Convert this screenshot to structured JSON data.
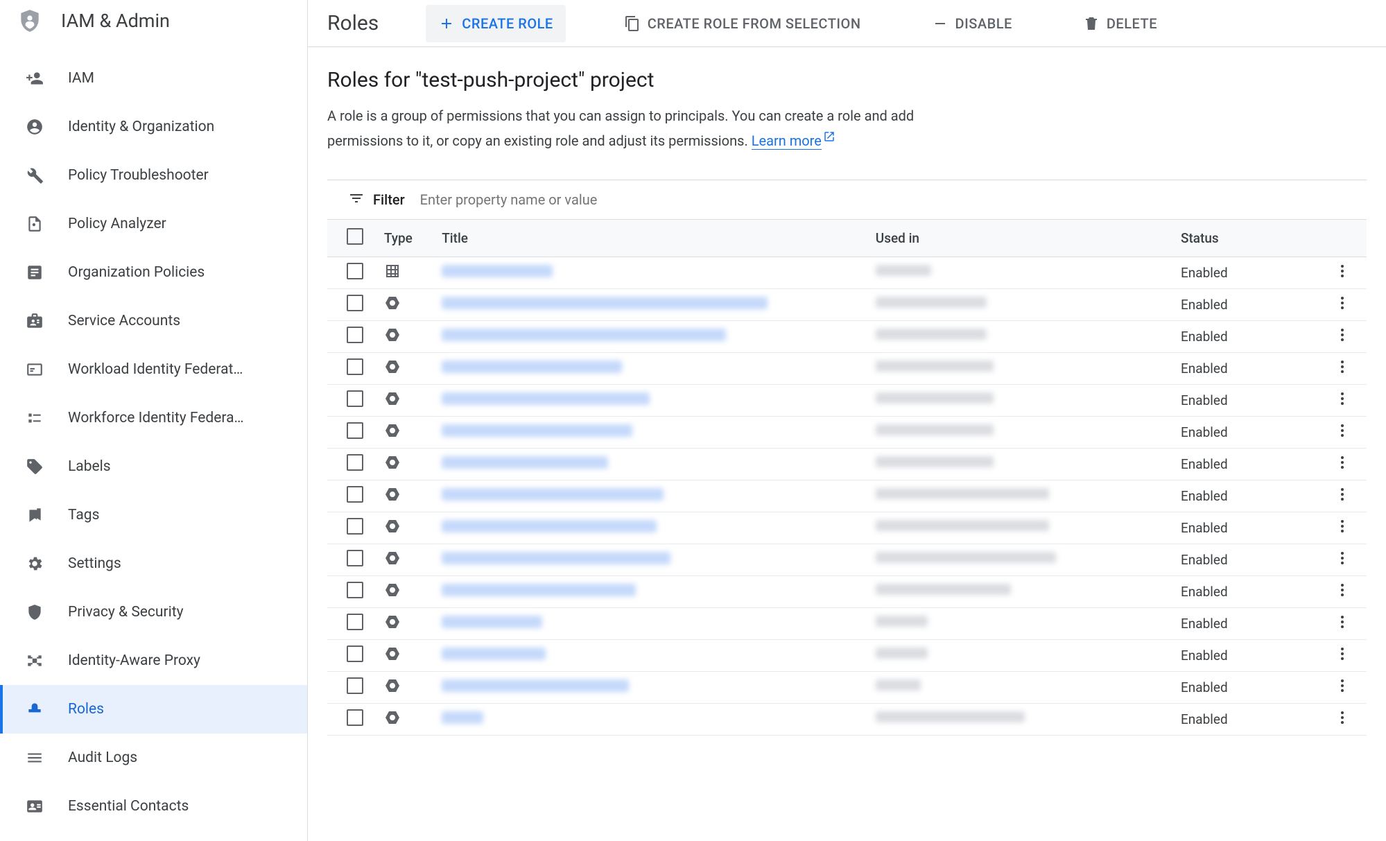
{
  "sidebar": {
    "product_name": "IAM & Admin",
    "items": [
      {
        "id": "iam",
        "label": "IAM",
        "icon": "person-plus"
      },
      {
        "id": "identity-org",
        "label": "Identity & Organization",
        "icon": "account-circle"
      },
      {
        "id": "policy-troubleshooter",
        "label": "Policy Troubleshooter",
        "icon": "wrench"
      },
      {
        "id": "policy-analyzer",
        "label": "Policy Analyzer",
        "icon": "doc-search"
      },
      {
        "id": "org-policies",
        "label": "Organization Policies",
        "icon": "article"
      },
      {
        "id": "service-accounts",
        "label": "Service Accounts",
        "icon": "badge"
      },
      {
        "id": "workload-identity",
        "label": "Workload Identity Federat…",
        "icon": "card"
      },
      {
        "id": "workforce-identity",
        "label": "Workforce Identity Federa…",
        "icon": "list"
      },
      {
        "id": "labels",
        "label": "Labels",
        "icon": "tag"
      },
      {
        "id": "tags",
        "label": "Tags",
        "icon": "bookmark"
      },
      {
        "id": "settings",
        "label": "Settings",
        "icon": "gear"
      },
      {
        "id": "privacy-security",
        "label": "Privacy & Security",
        "icon": "shield"
      },
      {
        "id": "iap",
        "label": "Identity-Aware Proxy",
        "icon": "proxy"
      },
      {
        "id": "roles",
        "label": "Roles",
        "icon": "hat",
        "active": true
      },
      {
        "id": "audit-logs",
        "label": "Audit Logs",
        "icon": "lines"
      },
      {
        "id": "essential-contacts",
        "label": "Essential Contacts",
        "icon": "contacts"
      }
    ]
  },
  "toolbar": {
    "title": "Roles",
    "create": "CREATE ROLE",
    "create_from_selection": "CREATE ROLE FROM SELECTION",
    "disable": "DISABLE",
    "delete": "DELETE"
  },
  "page": {
    "heading": "Roles for \"test-push-project\" project",
    "description": "A role is a group of permissions that you can assign to principals. You can create a role and add permissions to it, or copy an existing role and adjust its permissions. ",
    "learn_more": "Learn more"
  },
  "filter": {
    "label": "Filter",
    "placeholder": "Enter property name or value"
  },
  "table": {
    "headers": {
      "type": "Type",
      "title": "Title",
      "used_in": "Used in",
      "status": "Status"
    },
    "rows": [
      {
        "type": "custom",
        "title_w": 160,
        "used_w": 80,
        "status": "Enabled"
      },
      {
        "type": "hex",
        "title_w": 470,
        "used_w": 160,
        "status": "Enabled"
      },
      {
        "type": "hex",
        "title_w": 410,
        "used_w": 160,
        "status": "Enabled"
      },
      {
        "type": "hex",
        "title_w": 260,
        "used_w": 170,
        "status": "Enabled"
      },
      {
        "type": "hex",
        "title_w": 300,
        "used_w": 170,
        "status": "Enabled"
      },
      {
        "type": "hex",
        "title_w": 275,
        "used_w": 170,
        "status": "Enabled"
      },
      {
        "type": "hex",
        "title_w": 240,
        "used_w": 170,
        "status": "Enabled"
      },
      {
        "type": "hex",
        "title_w": 320,
        "used_w": 250,
        "status": "Enabled"
      },
      {
        "type": "hex",
        "title_w": 310,
        "used_w": 250,
        "status": "Enabled"
      },
      {
        "type": "hex",
        "title_w": 330,
        "used_w": 260,
        "status": "Enabled"
      },
      {
        "type": "hex",
        "title_w": 280,
        "used_w": 195,
        "status": "Enabled"
      },
      {
        "type": "hex",
        "title_w": 145,
        "used_w": 75,
        "status": "Enabled"
      },
      {
        "type": "hex",
        "title_w": 150,
        "used_w": 75,
        "status": "Enabled"
      },
      {
        "type": "hex",
        "title_w": 270,
        "used_w": 65,
        "status": "Enabled"
      },
      {
        "type": "hex",
        "title_w": 60,
        "used_w": 215,
        "status": "Enabled"
      }
    ]
  }
}
